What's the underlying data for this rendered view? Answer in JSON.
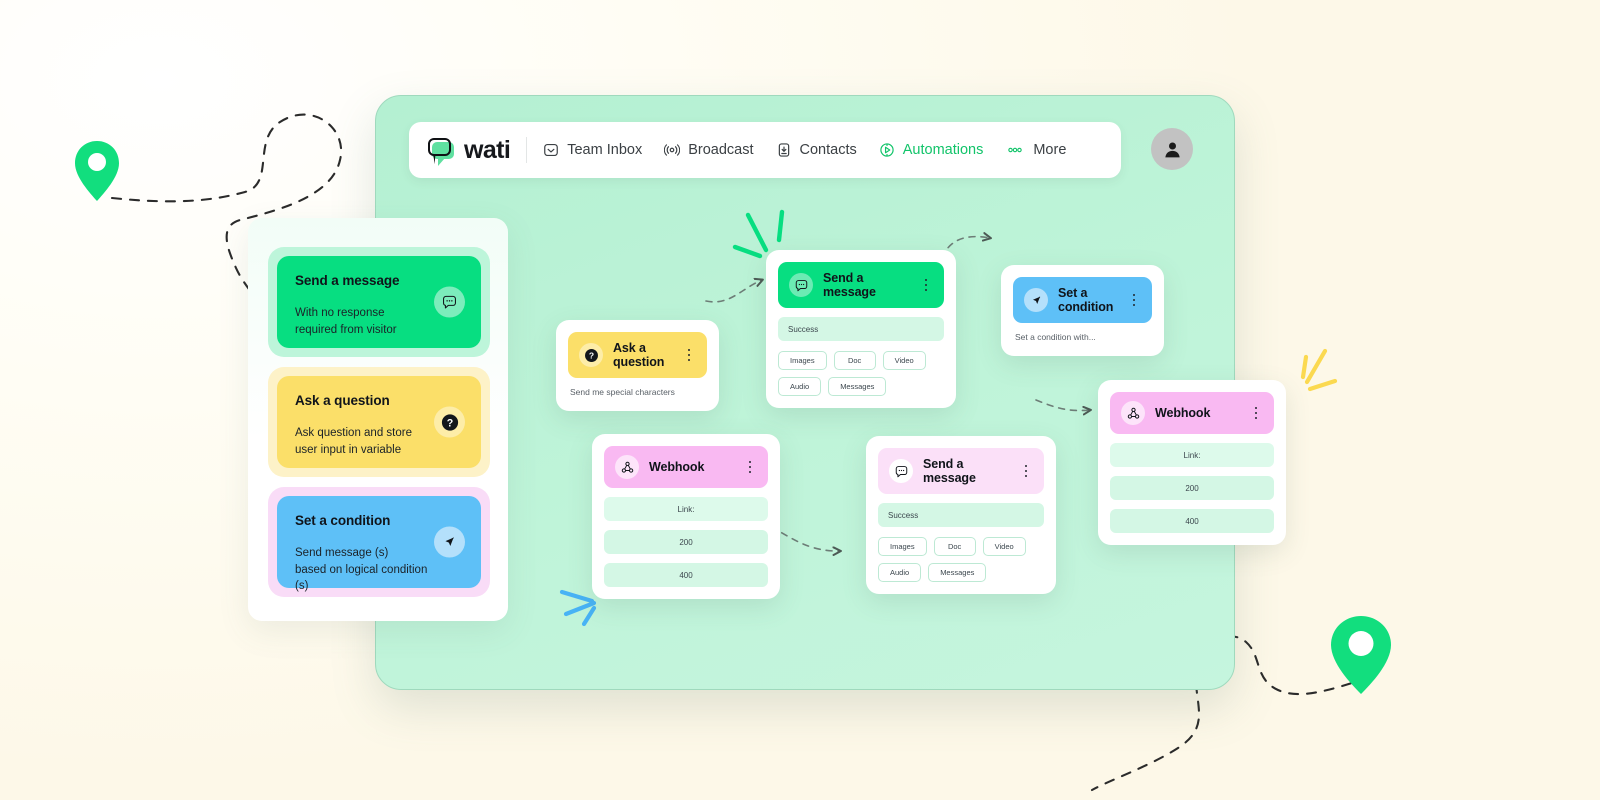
{
  "brand": {
    "name": "wati",
    "logo_icon": "speech-bubble-logo",
    "accent": "#07de81"
  },
  "nav": {
    "items": [
      {
        "label": "Team Inbox",
        "icon": "inbox-icon",
        "active": false
      },
      {
        "label": "Broadcast",
        "icon": "broadcast-icon",
        "active": false
      },
      {
        "label": "Contacts",
        "icon": "contacts-icon",
        "active": false
      },
      {
        "label": "Automations",
        "icon": "automations-icon",
        "active": true
      },
      {
        "label": "More",
        "icon": "ellipsis-icon",
        "active": false
      }
    ],
    "avatar_icon": "user-avatar-icon"
  },
  "sidebar": {
    "cards": [
      {
        "title": "Send a message",
        "desc": "With no response\nrequired from visitor",
        "icon": "chat-bubble-icon",
        "color": "#07de81"
      },
      {
        "title": "Ask a question",
        "desc": "Ask question and store\nuser input in variable",
        "icon": "question-mark-icon",
        "color": "#fbdf69"
      },
      {
        "title": "Set a condition",
        "desc": "Send message (s)\nbased on logical condition (s)",
        "icon": "cursor-arrow-icon",
        "color": "#5ec0f7"
      }
    ]
  },
  "canvas": {
    "nodes": [
      {
        "id": "ask",
        "title": "Ask a question",
        "icon": "question-mark-icon",
        "header_color": "#fbdf69",
        "subtitle": "Send me special characters",
        "menu_icon": "kebab-menu-icon"
      },
      {
        "id": "msg1",
        "title": "Send a message",
        "icon": "chat-bubble-icon",
        "header_color": "#07de81",
        "status_row": "Success",
        "chips": [
          "Images",
          "Doc",
          "Video",
          "Audio",
          "Messages"
        ],
        "menu_icon": "kebab-menu-icon"
      },
      {
        "id": "condition",
        "title": "Set a condition",
        "icon": "cursor-arrow-icon",
        "header_color": "#5ec0f7",
        "subtitle": "Set a condition with...",
        "menu_icon": "kebab-menu-icon"
      },
      {
        "id": "webhook1",
        "title": "Webhook",
        "icon": "webhook-icon",
        "header_color": "#f9b9f2",
        "rows": [
          "Link:",
          "200",
          "400"
        ],
        "menu_icon": "kebab-menu-icon"
      },
      {
        "id": "msg2",
        "title": "Send a message",
        "icon": "chat-bubble-icon",
        "header_color": "#fbe0f8",
        "status_row": "Success",
        "chips": [
          "Images",
          "Doc",
          "Video",
          "Audio",
          "Messages"
        ],
        "menu_icon": "kebab-menu-icon"
      },
      {
        "id": "webhook2",
        "title": "Webhook",
        "icon": "webhook-icon",
        "header_color": "#f9b9f2",
        "rows": [
          "Link:",
          "200",
          "400"
        ],
        "menu_icon": "kebab-menu-icon"
      }
    ]
  },
  "decor": {
    "pins": [
      "map-pin-left",
      "map-pin-bottom-right"
    ],
    "sparks": [
      "green-spark",
      "blue-spark",
      "yellow-spark"
    ],
    "pin_color": "#12de7e"
  }
}
